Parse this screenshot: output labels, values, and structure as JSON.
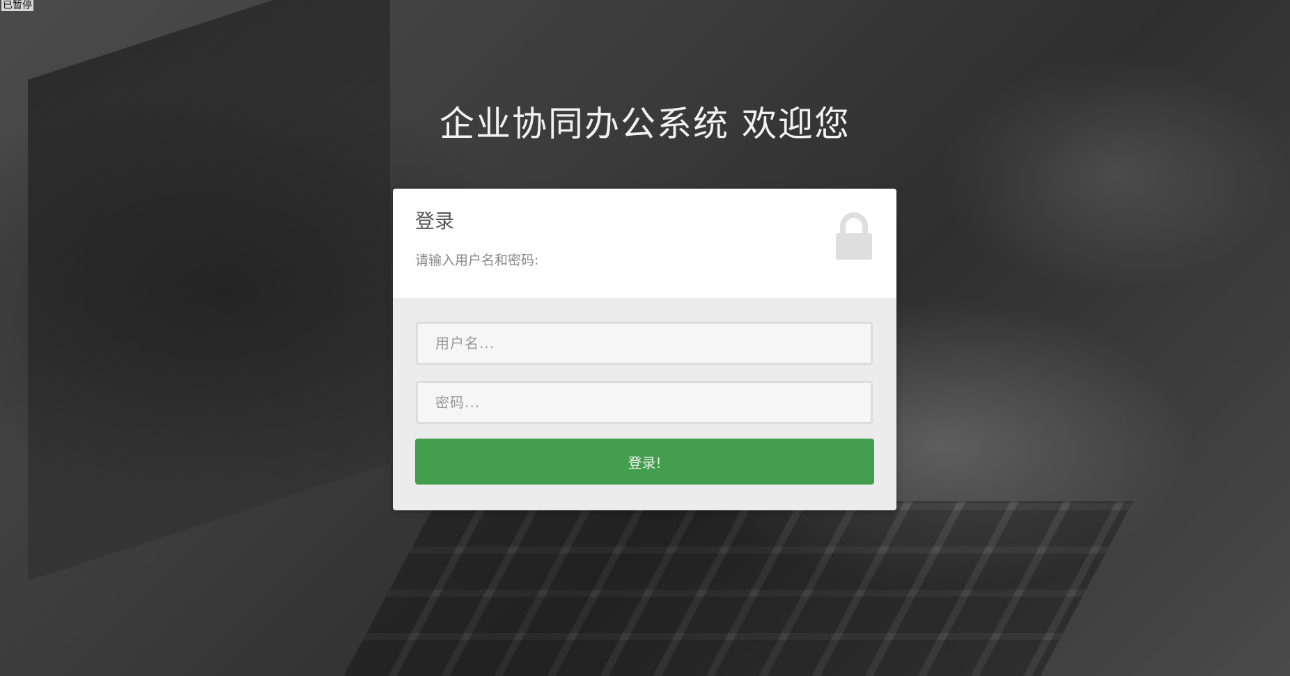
{
  "status_overlay": "已暂停",
  "page": {
    "title": "企业协同办公系统  欢迎您"
  },
  "login_card": {
    "heading": "登录",
    "subtitle": "请输入用户名和密码:",
    "lock_icon": "lock-icon",
    "username_placeholder": "用户名...",
    "password_placeholder": "密码...",
    "submit_label": "登录!",
    "colors": {
      "button": "#439f4d",
      "header_bg": "#ffffff",
      "form_bg": "#ececec"
    }
  }
}
